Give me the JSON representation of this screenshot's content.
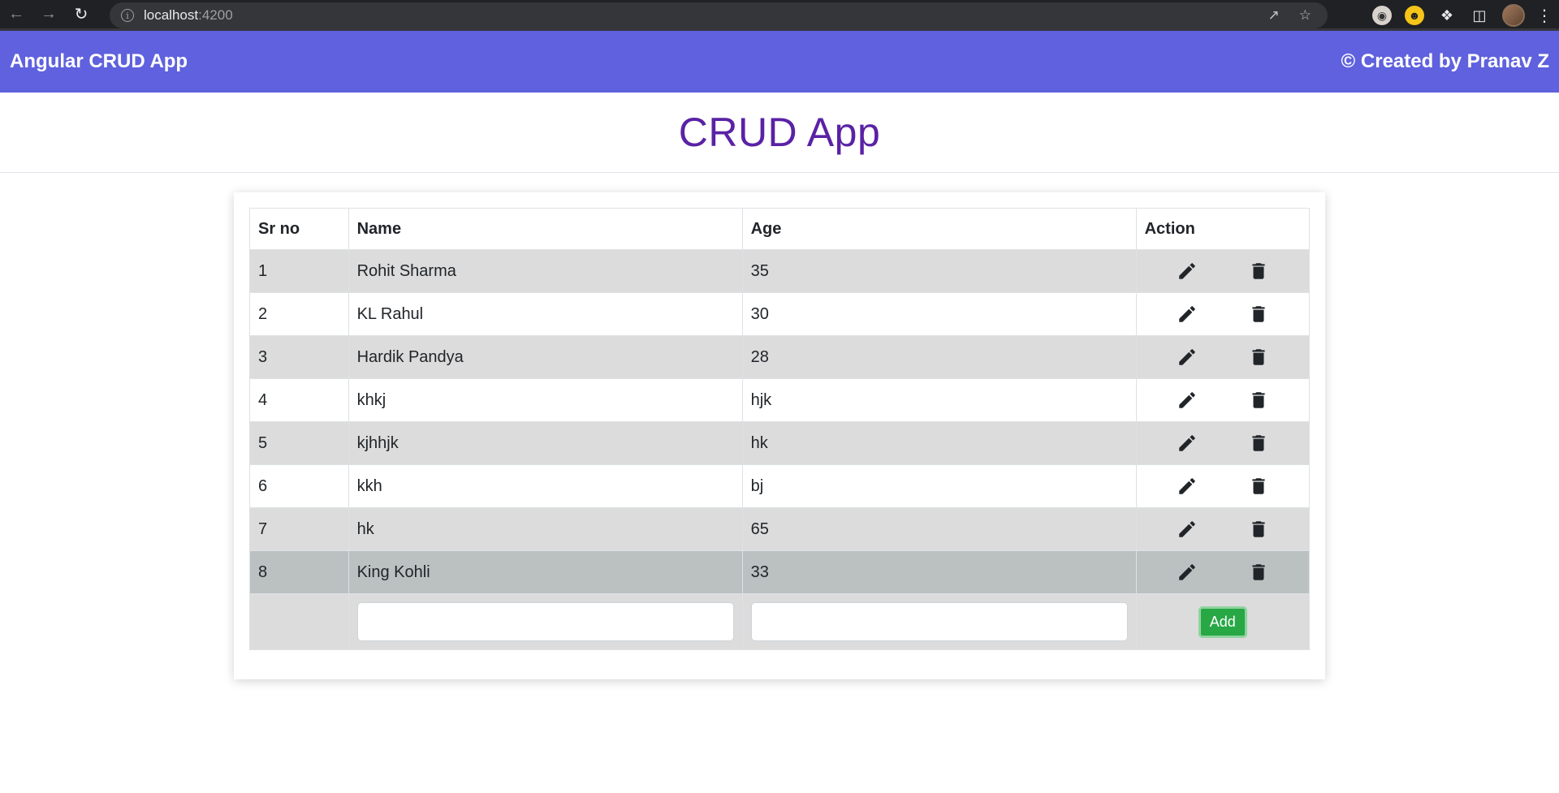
{
  "browser": {
    "url_host": "localhost",
    "url_port": ":4200"
  },
  "navbar": {
    "brand": "Angular CRUD App",
    "credit": "© Created by Pranav Z"
  },
  "page": {
    "title": "CRUD App"
  },
  "table": {
    "headers": {
      "sr": "Sr no",
      "name": "Name",
      "age": "Age",
      "action": "Action"
    },
    "rows": [
      {
        "sr": "1",
        "name": "Rohit Sharma",
        "age": "35"
      },
      {
        "sr": "2",
        "name": "KL Rahul",
        "age": "30"
      },
      {
        "sr": "3",
        "name": "Hardik Pandya",
        "age": "28"
      },
      {
        "sr": "4",
        "name": "khkj",
        "age": "hjk"
      },
      {
        "sr": "5",
        "name": "kjhhjk",
        "age": "hk"
      },
      {
        "sr": "6",
        "name": "kkh",
        "age": "bj"
      },
      {
        "sr": "7",
        "name": "hk",
        "age": "65"
      },
      {
        "sr": "8",
        "name": "King Kohli",
        "age": "33"
      }
    ],
    "add_row": {
      "name_value": "",
      "age_value": "",
      "add_label": "Add"
    }
  },
  "colors": {
    "navbar": "#5f61de",
    "title": "#5a22a5",
    "add_button": "#28a745",
    "stripe": "#dcdcdc",
    "highlight": "#bbc0c1"
  },
  "icons": {
    "edit": "pencil-icon",
    "delete": "trash-icon"
  }
}
